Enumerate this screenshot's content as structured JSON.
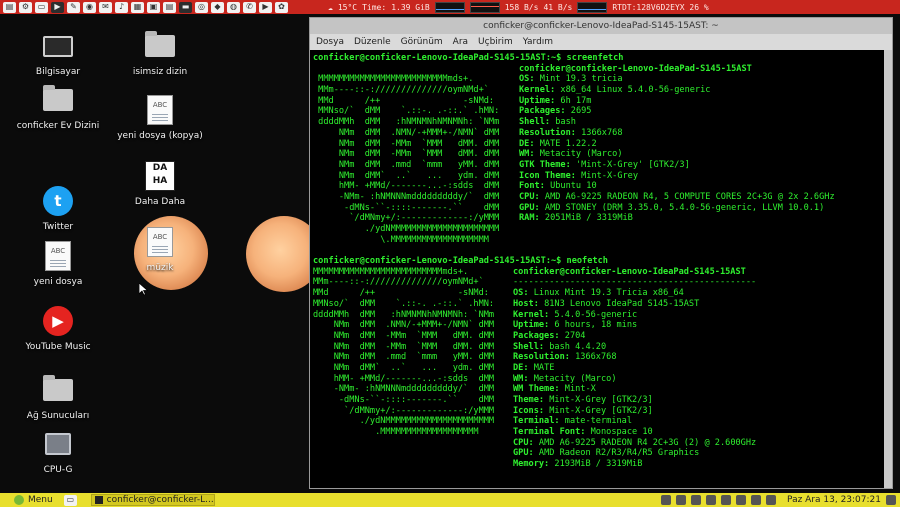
{
  "top_panel": {
    "applets": {
      "temperature": "15°C",
      "time_label": "Time:",
      "mem": "1.39 GiB",
      "net_down": "158 B/s",
      "net_up": "41 B/s",
      "device": "RTDT:128V6D2EYX 26 %"
    }
  },
  "desktop": {
    "icons": [
      {
        "label": "Bilgisayar",
        "icon": "computer-icon"
      },
      {
        "label": "isimsiz dizin",
        "icon": "folder-icon"
      },
      {
        "label": "conficker Ev Dizini",
        "icon": "home-folder-icon"
      },
      {
        "label": "yeni dosya (kopya)",
        "icon": "text-document-icon"
      },
      {
        "label": "Daha Daha",
        "icon": "daha-daha-app-icon"
      },
      {
        "label": "Twitter",
        "icon": "twitter-icon"
      },
      {
        "label": "yeni dosya",
        "icon": "text-document-icon"
      },
      {
        "label": "müzik",
        "icon": "text-document-icon"
      },
      {
        "label": "YouTube Music",
        "icon": "youtube-music-icon"
      },
      {
        "label": "Ağ Sunucuları",
        "icon": "network-servers-icon"
      },
      {
        "label": "CPU-G",
        "icon": "cpu-g-icon"
      }
    ]
  },
  "terminal": {
    "title": "conficker@conficker-Lenovo-IdeaPad-S145-15AST: ~",
    "menu": [
      "Dosya",
      "Düzenle",
      "Görünüm",
      "Ara",
      "Uçbirim",
      "Yardım"
    ],
    "prompt1": "conficker@conficker-Lenovo-IdeaPad-S145-15AST:~$ screenfetch",
    "sf_user_host": "conficker@conficker-Lenovo-IdeaPad-S145-15AST",
    "sf_art": [
      "",
      " MMMMMMMMMMMMMMMMMMMMMMMMMmds+.",
      " MMm----::-://////////////oymNMd+`",
      " MMd      /++                -sNMd:",
      " MMNso/`  dMM    `.::-. .-::.` .hMN:",
      " ddddMMh  dMM   :hNMNMNhNMNMNh: `NMm",
      "     NMm  dMM  .NMN/-+MMM+-/NMN` dMM",
      "     NMm  dMM  -MMm  `MMM   dMM. dMM",
      "     NMm  dMM  -MMm  `MMM   dMM. dMM",
      "     NMm  dMM  .mmd  `mmm   yMM. dMM",
      "     NMm  dMM`  ..`   ...   ydm. dMM",
      "     hMM- +MMd/-------...-:sdds  dMM",
      "     -NMm- :hNMNNNmdddddddddy/`  dMM",
      "      -dMNs-``-::::-------.``    dMM",
      "       `/dMNmy+/:-------------:/yMMM",
      "          ./ydNMMMMMMMMMMMMMMMMMMMMM",
      "             \\.MMMMMMMMMMMMMMMMMMM"
    ],
    "sf_info": [
      {
        "k": "OS:",
        "v": "Mint 19.3 tricia"
      },
      {
        "k": "Kernel:",
        "v": "x86_64 Linux 5.4.0-56-generic"
      },
      {
        "k": "Uptime:",
        "v": "6h 17m"
      },
      {
        "k": "Packages:",
        "v": "2695"
      },
      {
        "k": "Shell:",
        "v": "bash"
      },
      {
        "k": "Resolution:",
        "v": "1366x768"
      },
      {
        "k": "DE:",
        "v": "MATE 1.22.2"
      },
      {
        "k": "WM:",
        "v": "Metacity (Marco)"
      },
      {
        "k": "GTK Theme:",
        "v": "'Mint-X-Grey' [GTK2/3]"
      },
      {
        "k": "Icon Theme:",
        "v": "Mint-X-Grey"
      },
      {
        "k": "Font:",
        "v": "Ubuntu 10"
      },
      {
        "k": "CPU:",
        "v": "AMD A6-9225 RADEON R4, 5 COMPUTE CORES 2C+3G @ 2x 2.6GHz"
      },
      {
        "k": "GPU:",
        "v": "AMD STONEY (DRM 3.35.0, 5.4.0-56-generic, LLVM 10.0.1)"
      },
      {
        "k": "RAM:",
        "v": "2051MiB / 3319MiB"
      }
    ],
    "prompt2": "conficker@conficker-Lenovo-IdeaPad-S145-15AST:~$ neofetch",
    "nf_user_host": "conficker@conficker-Lenovo-IdeaPad-S145-15AST",
    "nf_separator": "-----------------------------------------------",
    "nf_art": [
      "MMMMMMMMMMMMMMMMMMMMMMMMMmds+.",
      "MMm----::-://////////////oymNMd+`",
      "MMd      /++                -sNMd:",
      "MMNso/`  dMM    `.::-. .-::.` .hMN:",
      "ddddMMh  dMM   :hNMNMNhNMNMNh: `NMm",
      "    NMm  dMM  .NMN/-+MMM+-/NMN` dMM",
      "    NMm  dMM  -MMm  `MMM   dMM. dMM",
      "    NMm  dMM  -MMm  `MMM   dMM. dMM",
      "    NMm  dMM  .mmd  `mmm   yMM. dMM",
      "    NMm  dMM`  ..`   ...   ydm. dMM",
      "    hMM- +MMd/-------...-:sdds  dMM",
      "    -NMm- :hNMNNNmdddddddddy/`  dMM",
      "     -dMNs-``-::::-------.``    dMM",
      "      `/dMNmy+/:-------------:/yMMM",
      "         ./ydNMMMMMMMMMMMMMMMMMMMMM",
      "            .MMMMMMMMMMMMMMMMMMM"
    ],
    "nf_info": [
      {
        "k": "OS:",
        "v": "Linux Mint 19.3 Tricia x86_64"
      },
      {
        "k": "Host:",
        "v": "81N3 Lenovo IdeaPad S145-15AST"
      },
      {
        "k": "Kernel:",
        "v": "5.4.0-56-generic"
      },
      {
        "k": "Uptime:",
        "v": "6 hours, 18 mins"
      },
      {
        "k": "Packages:",
        "v": "2704"
      },
      {
        "k": "Shell:",
        "v": "bash 4.4.20"
      },
      {
        "k": "Resolution:",
        "v": "1366x768"
      },
      {
        "k": "DE:",
        "v": "MATE"
      },
      {
        "k": "WM:",
        "v": "Metacity (Marco)"
      },
      {
        "k": "WM Theme:",
        "v": "Mint-X"
      },
      {
        "k": "Theme:",
        "v": "Mint-X-Grey [GTK2/3]"
      },
      {
        "k": "Icons:",
        "v": "Mint-X-Grey [GTK2/3]"
      },
      {
        "k": "Terminal:",
        "v": "mate-terminal"
      },
      {
        "k": "Terminal Font:",
        "v": "Monospace 10"
      },
      {
        "k": "CPU:",
        "v": "AMD A6-9225 RADEON R4 2C+3G (2) @ 2.600GHz"
      },
      {
        "k": "GPU:",
        "v": "AMD Radeon R2/R3/R4/R5 Graphics"
      },
      {
        "k": "Memory:",
        "v": "2193MiB / 3319MiB"
      }
    ]
  },
  "bottom_panel": {
    "menu_label": "Menu",
    "task_label": "conficker@conficker-L...",
    "clock": "Paz Ara 13, 23:07:21"
  },
  "colors": {
    "top_panel": "#c8261e",
    "bottom_panel": "#e8df2e",
    "terminal_text": "#2ff02f"
  }
}
